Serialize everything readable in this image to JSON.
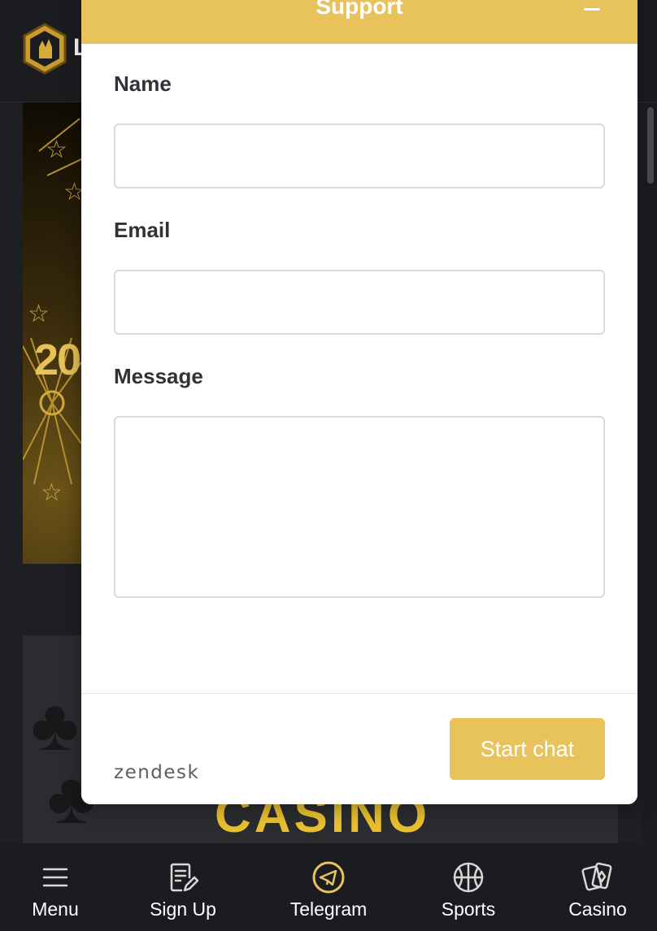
{
  "site": {
    "logo_letter": "L",
    "banner_text": "20",
    "casino_title": "CASINO"
  },
  "support": {
    "title": "Support",
    "fields": [
      {
        "label": "Name",
        "value": ""
      },
      {
        "label": "Email",
        "value": ""
      },
      {
        "label": "Message",
        "value": ""
      }
    ],
    "branding": "zendesk",
    "start_button": "Start chat"
  },
  "nav": {
    "items": [
      {
        "label": "Menu",
        "icon": "hamburger-icon"
      },
      {
        "label": "Sign Up",
        "icon": "edit-form-icon"
      },
      {
        "label": "Telegram",
        "icon": "telegram-icon"
      },
      {
        "label": "Sports",
        "icon": "basketball-icon"
      },
      {
        "label": "Casino",
        "icon": "cards-icon"
      }
    ]
  },
  "colors": {
    "accent": "#e8c35c",
    "nav_background": "#1b1c1f",
    "page_background": "#1e1f22",
    "casino_gold": "#e8bf2f"
  }
}
